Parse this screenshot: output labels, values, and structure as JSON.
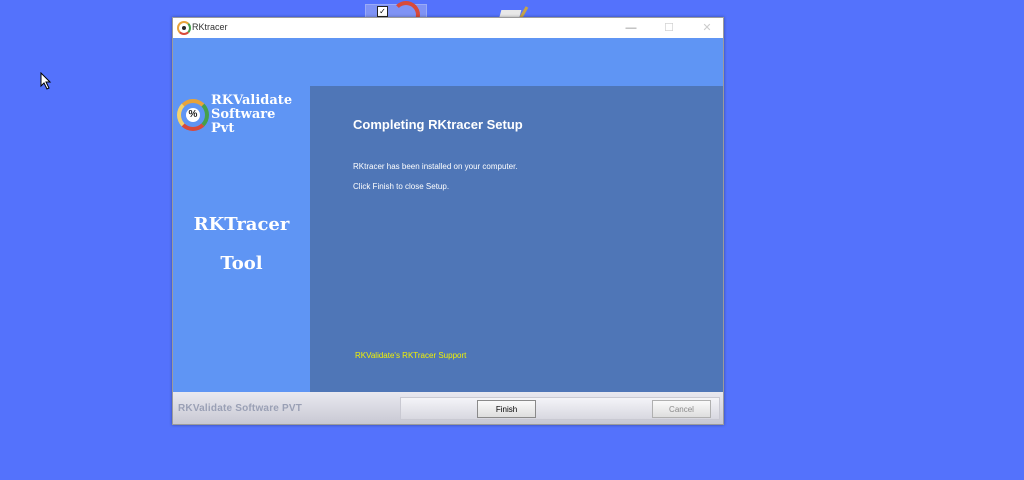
{
  "window": {
    "title": "RKtracer",
    "minimize_glyph": "—",
    "maximize_glyph": "☐",
    "close_glyph": "✕"
  },
  "sidebar": {
    "brand_lines": [
      "RKValidate",
      "Software",
      "Pvt"
    ],
    "logo_symbol": "%",
    "tool_title_line1": "RKTracer",
    "tool_title_line2": "Tool"
  },
  "content": {
    "heading": "Completing RKtracer Setup",
    "line1": "RKtracer has been installed on your computer.",
    "line2": "Click Finish to close Setup.",
    "support_link": "RKValidate's RKTracer Support"
  },
  "footer": {
    "brand": "RKValidate Software PVT",
    "finish_label": "Finish",
    "cancel_label": "Cancel"
  },
  "colors": {
    "desktop": "#5472fc",
    "sidebar": "#5f95f4",
    "content": "#4f76b7",
    "link": "#f2f200"
  }
}
